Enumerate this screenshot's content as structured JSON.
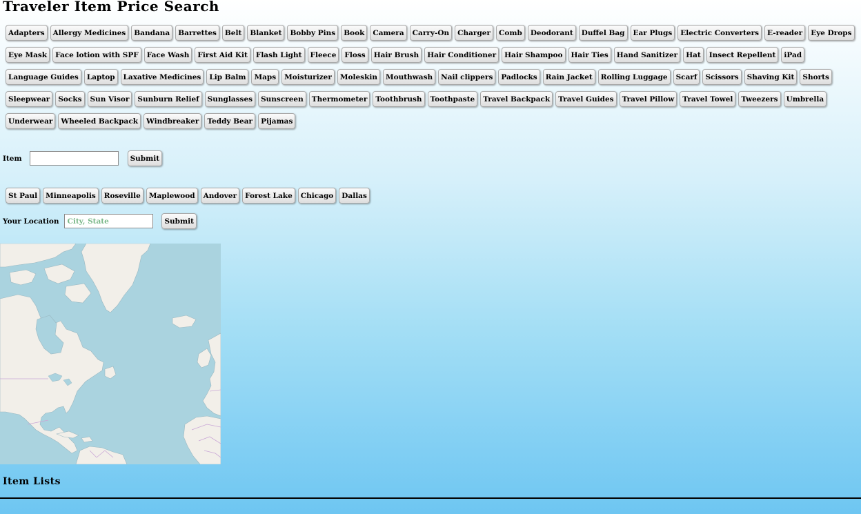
{
  "page": {
    "title": "Traveler Item Price Search"
  },
  "items": [
    "Adapters",
    "Allergy Medicines",
    "Bandana",
    "Barrettes",
    "Belt",
    "Blanket",
    "Bobby Pins",
    "Book",
    "Camera",
    "Carry-On",
    "Charger",
    "Comb",
    "Deodorant",
    "Duffel Bag",
    "Ear Plugs",
    "Electric Converters",
    "E-reader",
    "Eye Drops",
    "Eye Mask",
    "Face lotion with SPF",
    "Face Wash",
    "First Aid Kit",
    "Flash Light",
    "Fleece",
    "Floss",
    "Hair Brush",
    "Hair Conditioner",
    "Hair Shampoo",
    "Hair Ties",
    "Hand Sanitizer",
    "Hat",
    "Insect Repellent",
    "iPad",
    "Language Guides",
    "Laptop",
    "Laxative Medicines",
    "Lip Balm",
    "Maps",
    "Moisturizer",
    "Moleskin",
    "Mouthwash",
    "Nail clippers",
    "Padlocks",
    "Rain Jacket",
    "Rolling Luggage",
    "Scarf",
    "Scissors",
    "Shaving Kit",
    "Shorts",
    "Sleepwear",
    "Socks",
    "Sun Visor",
    "Sunburn Relief",
    "Sunglasses",
    "Sunscreen",
    "Thermometer",
    "Toothbrush",
    "Toothpaste",
    "Travel Backpack",
    "Travel Guides",
    "Travel Pillow",
    "Travel Towel",
    "Tweezers",
    "Umbrella",
    "Underwear",
    "Wheeled Backpack",
    "Windbreaker",
    "Teddy Bear",
    "Pijamas"
  ],
  "item_form": {
    "label": "Item",
    "value": "",
    "submit_label": "Submit"
  },
  "cities": [
    "St Paul",
    "Minneapolis",
    "Roseville",
    "Maplewood",
    "Andover",
    "Forest Lake",
    "Chicago",
    "Dallas"
  ],
  "location_form": {
    "label": "Your Location",
    "placeholder": "City, State",
    "value": "",
    "submit_label": "Submit"
  },
  "map": {
    "water_color": "#aad3df",
    "land_color": "#f2efe9",
    "border_color": "#c9a6d6"
  },
  "item_lists": {
    "heading": "Item Lists"
  }
}
